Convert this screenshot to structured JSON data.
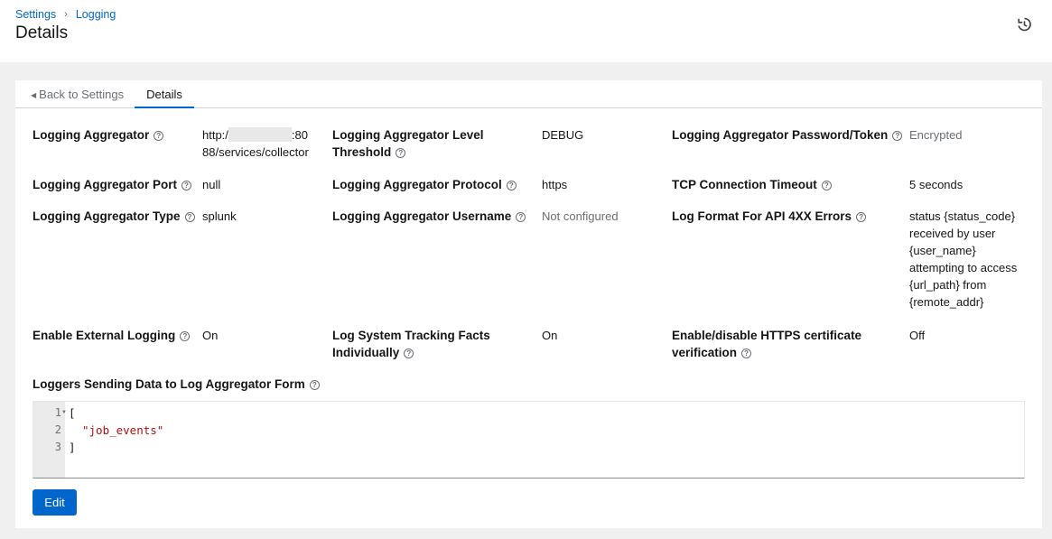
{
  "breadcrumb": {
    "settings": "Settings",
    "logging": "Logging"
  },
  "page_title": "Details",
  "icons": {
    "history": "history-icon",
    "help": "question-circle-icon",
    "back": "caret-left-icon"
  },
  "tabs": {
    "back": "Back to Settings",
    "details": "Details"
  },
  "fields": {
    "aggregator_label": "Logging Aggregator",
    "aggregator_value_1": "http:/",
    "aggregator_value_2": ":80",
    "aggregator_value_3": "88/services/collector",
    "level_label_1": "Logging Aggregator Level",
    "level_label_2": "Threshold",
    "level_value": "DEBUG",
    "password_label": "Logging Aggregator Password/Token",
    "password_value": "Encrypted",
    "port_label": "Logging Aggregator Port",
    "port_value": "null",
    "protocol_label": "Logging Aggregator Protocol",
    "protocol_value": "https",
    "tcp_label": "TCP Connection Timeout",
    "tcp_value": "5 seconds",
    "type_label": "Logging Aggregator Type",
    "type_value": "splunk",
    "username_label": "Logging Aggregator Username",
    "username_value": "Not configured",
    "format_label": "Log Format For API 4XX Errors",
    "format_lines": [
      "status {status_code}",
      "received by user",
      "{user_name}",
      "attempting to access",
      "{url_path} from",
      "{remote_addr}"
    ],
    "external_label": "Enable External Logging",
    "external_value": "On",
    "tracking_label_1": "Log System Tracking Facts",
    "tracking_label_2": "Individually",
    "tracking_value": "On",
    "https_label_1": "Enable/disable HTTPS certificate",
    "https_label_2": "verification",
    "https_value": "Off",
    "loggers_label": "Loggers Sending Data to Log Aggregator Form"
  },
  "editor": {
    "line_numbers": [
      "1",
      "2",
      "3"
    ],
    "lines": [
      "[",
      "\"job_events\"",
      "]"
    ]
  },
  "buttons": {
    "edit": "Edit"
  },
  "colors": {
    "accent": "#0066cc",
    "string": "#a11111"
  }
}
